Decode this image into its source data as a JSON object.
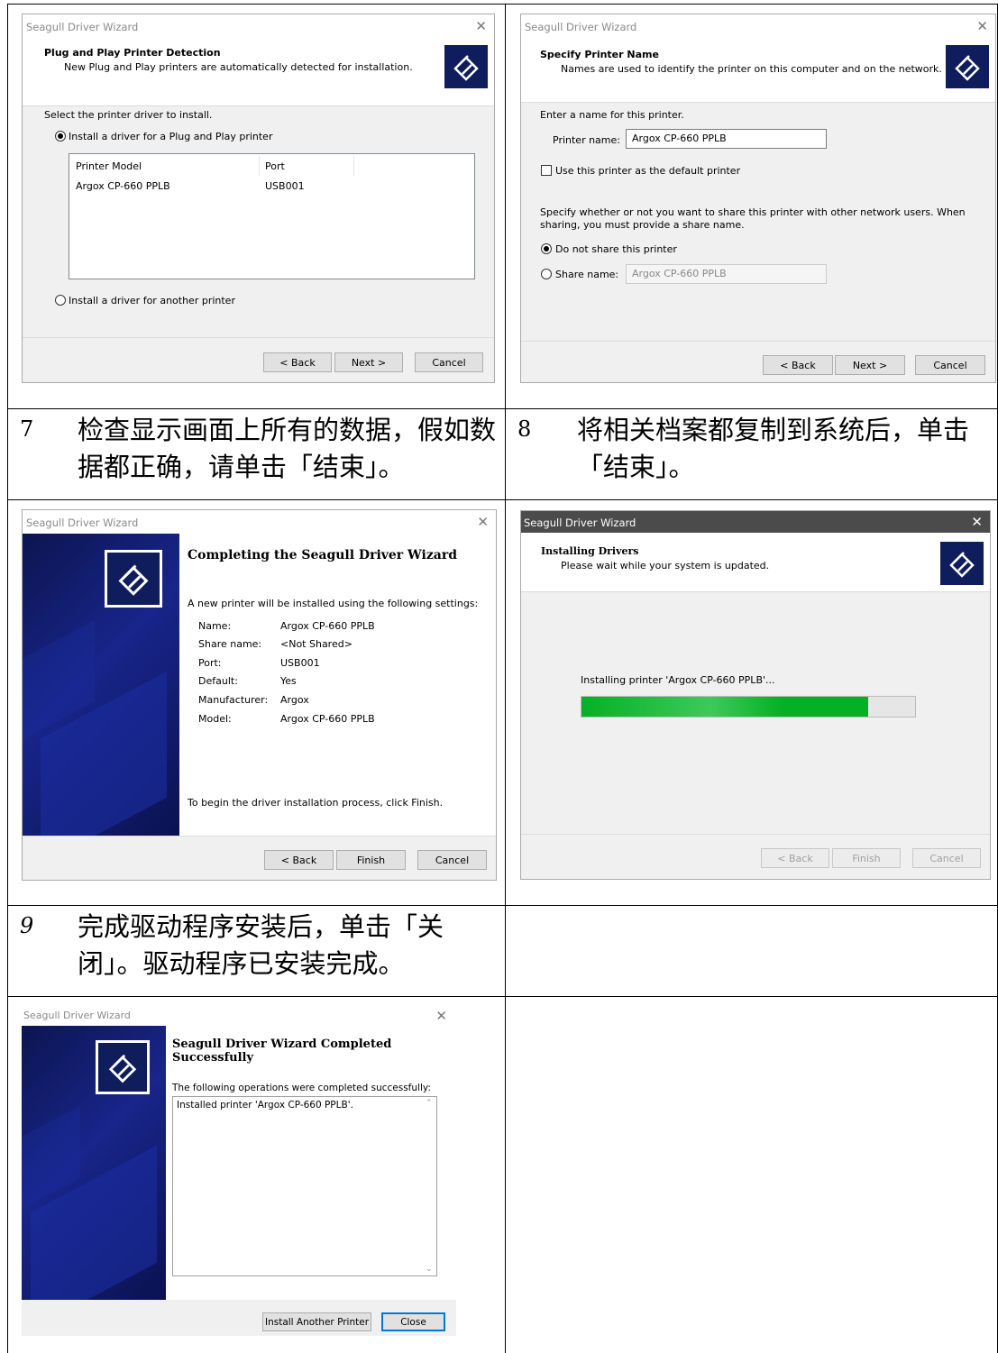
{
  "wizard_title": "Seagull Driver Wizard",
  "close_glyph": "✕",
  "buttons": {
    "back": "< Back",
    "next": "Next >",
    "cancel": "Cancel",
    "finish": "Finish",
    "install_another": "Install Another Printer",
    "close": "Close"
  },
  "dialog1": {
    "header_title": "Plug and Play Printer Detection",
    "header_sub": "New Plug and Play printers are automatically detected for installation.",
    "prompt": "Select the printer driver to install.",
    "option_pnp": "Install a driver for a Plug and Play printer",
    "columns": [
      "Printer Model",
      "Port"
    ],
    "rows": [
      {
        "model": "Argox CP-660 PPLB",
        "port": "USB001"
      }
    ],
    "option_other": "Install a driver for another printer"
  },
  "dialog2": {
    "header_title": "Specify Printer Name",
    "header_sub": "Names are used to identify the printer on this computer and on the network.",
    "prompt": "Enter a name for this printer.",
    "name_label": "Printer name:",
    "name_value": "Argox CP-660 PPLB",
    "default_label": "Use this printer as the default printer",
    "share_text": "Specify whether or not you want to share this printer with other network users.  When sharing, you must provide a share name.",
    "no_share_label": "Do not share this printer",
    "share_name_label": "Share name:",
    "share_name_value": "Argox CP-660 PPLB"
  },
  "step7": {
    "number": "7",
    "text": "检查显示画面上所有的数据，假如数据都正确，请单击「结束」。"
  },
  "step8": {
    "number": "8",
    "text": "将相关档案都复制到系统后，单击「结束」。"
  },
  "dialog3": {
    "heading": "Completing the Seagull Driver Wizard",
    "intro": "A new printer will be installed using the following settings:",
    "settings": [
      {
        "key": "Name:",
        "value": "Argox CP-660 PPLB"
      },
      {
        "key": "Share name:",
        "value": "<Not Shared>"
      },
      {
        "key": "Port:",
        "value": "USB001"
      },
      {
        "key": "Default:",
        "value": "Yes"
      },
      {
        "key": "Manufacturer:",
        "value": "Argox"
      },
      {
        "key": "Model:",
        "value": "Argox CP-660 PPLB"
      }
    ],
    "outro": "To begin the driver installation process, click Finish."
  },
  "dialog4": {
    "header_title": "Installing Drivers",
    "header_sub": "Please wait while your system is updated.",
    "status": "Installing printer 'Argox CP-660 PPLB'...",
    "progress": 0.86
  },
  "step9": {
    "number": "9",
    "text": "完成驱动程序安装后，单击「关闭」。驱动程序已安装完成。"
  },
  "dialog5": {
    "heading": "Seagull Driver Wizard Completed Successfully",
    "intro": "The following operations were completed successfully:",
    "log": "Installed printer 'Argox CP-660 PPLB'."
  }
}
